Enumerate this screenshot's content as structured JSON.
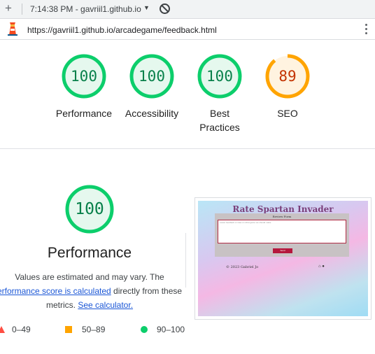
{
  "browser": {
    "new_tab_symbol": "+",
    "title": "7:14:38 PM - gavriil1.github.io",
    "caret": "▼",
    "url": "https://gavriil1.github.io/arcadegame/feedback.html"
  },
  "gauges": [
    {
      "score": "100",
      "label": "Performance",
      "value": 100,
      "color": "#0cce6b",
      "text_color": "#08804a",
      "fill": "#e5f8ee"
    },
    {
      "score": "100",
      "label": "Accessibility",
      "value": 100,
      "color": "#0cce6b",
      "text_color": "#08804a",
      "fill": "#e5f8ee"
    },
    {
      "score": "100",
      "label": "Best Practices",
      "value": 100,
      "color": "#0cce6b",
      "text_color": "#08804a",
      "fill": "#e5f8ee"
    },
    {
      "score": "89",
      "label": "SEO",
      "value": 89,
      "color": "#ffa400",
      "text_color": "#c33300",
      "fill": "#fff3e0"
    }
  ],
  "performance": {
    "score": "100",
    "value": 100,
    "title": "Performance",
    "desc_part1": "Values are estimated and may vary. The",
    "desc_link1": "erformance score is calculated",
    "desc_part2": " directly from these",
    "desc_part3": "metrics. ",
    "desc_link2": "See calculator."
  },
  "legend": {
    "fail": "0–49",
    "average": "50–89",
    "pass": "90–100",
    "fail_color": "#ff4e42",
    "average_color": "#ffa400",
    "pass_color": "#0cce6b"
  },
  "screenshot": {
    "title": "Rate Spartan Invader",
    "form_label": "Review Form",
    "placeholder": "Leave feedback or idea on what game we should make",
    "button": "Send",
    "copyright": "© 2023 Gabriel Jo",
    "footer_icons": "⌂ ●"
  }
}
